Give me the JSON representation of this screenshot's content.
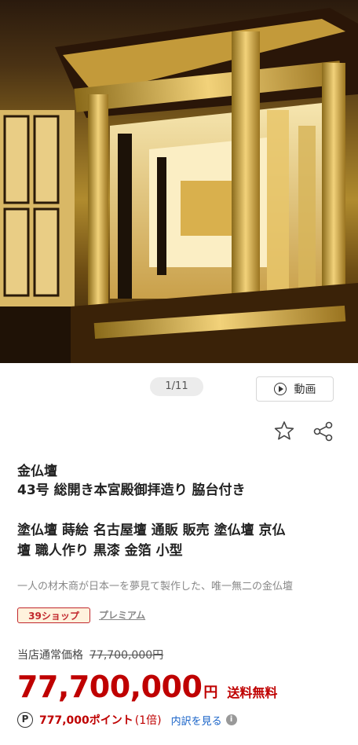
{
  "gallery": {
    "pager": "1/11",
    "video_label": "動画"
  },
  "product": {
    "title_line1": "金仏壇",
    "title_line2": "43号 総開き本宮殿御拝造り 脇台付き",
    "subtitle_line1": "塗仏壇 蒔絵 名古屋壇 通販 販売 塗仏壇 京仏",
    "subtitle_line2": "壇 職人作り 黒漆 金箔 小型",
    "description": "一人の材木商が日本一を夢見て製作した、唯一無二の金仏壇"
  },
  "badges": {
    "shop": "39ショップ",
    "premium": "プレミアム"
  },
  "pricing": {
    "regular_label": "当店通常価格",
    "regular_price": "77,700,000円",
    "price": "77,700,000",
    "yen": "円",
    "shipping": "送料無料"
  },
  "points": {
    "icon_letter": "P",
    "value": "777,000ポイント",
    "multiplier": "(1倍)",
    "link": "内訳を見る",
    "info_glyph": "i"
  },
  "colors": {
    "price_red": "#bf0000",
    "link_blue": "#1a64c8"
  }
}
